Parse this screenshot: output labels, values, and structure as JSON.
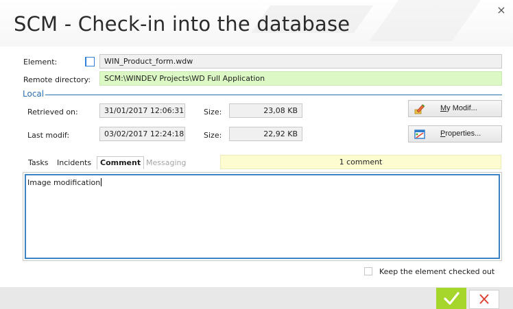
{
  "window": {
    "title": "SCM - Check-in into the database",
    "close_glyph": "×"
  },
  "element": {
    "label": "Element:",
    "icon": "file-icon",
    "value": "WIN_Product_form.wdw"
  },
  "remote": {
    "label": "Remote directory:",
    "value": "SCM:\\WINDEV Projects\\WD Full Application"
  },
  "local": {
    "legend": "Local",
    "retrieved_label": "Retrieved on:",
    "retrieved_value": "31/01/2017 12:06:31",
    "retrieved_size_label": "Size:",
    "retrieved_size_value": "23,08 KB",
    "modif_label": "Last modif:",
    "modif_value": "03/02/2017 12:24:18",
    "modif_size_label": "Size:",
    "modif_size_value": "22,92 KB"
  },
  "buttons": {
    "my_modif": "My Modif...",
    "my_modif_icon": "pencil-edit-icon",
    "properties": "Properties...",
    "properties_icon": "properties-icon"
  },
  "tabs": [
    {
      "label": "Tasks"
    },
    {
      "label": "Incidents"
    },
    {
      "label": "Comment",
      "active": true
    },
    {
      "label": "Messaging",
      "disabled": true
    }
  ],
  "comment_count": "1 comment",
  "comment_text": "Image modification",
  "keep_checked_out": {
    "label": "Keep the element checked out",
    "checked": false
  },
  "footer": {
    "ok_icon": "checkmark-icon",
    "cancel_icon": "cross-icon"
  },
  "colors": {
    "accent_blue": "#2b6fb3",
    "ok_green": "#a6d62b",
    "cancel_red": "#e0412f",
    "remote_field_green": "#dcf8c4",
    "comment_count_yellow": "#fdfbd0"
  }
}
